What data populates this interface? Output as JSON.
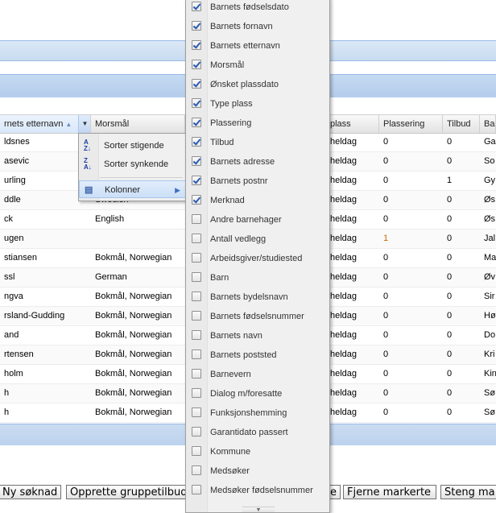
{
  "columns": {
    "etternavn": "rnets etternavn",
    "morsmal": "Morsmål",
    "plass": "plass",
    "plassering": "Plassering",
    "tilbud": "Tilbud",
    "ba": "Ba"
  },
  "rows": [
    {
      "etternavn": "ldsnes",
      "morsmal": "",
      "plass": "heldag",
      "plassering": "0",
      "tilbud": "0",
      "ba": "Ga"
    },
    {
      "etternavn": "asevic",
      "morsmal": "",
      "plass": "heldag",
      "plassering": "0",
      "tilbud": "0",
      "ba": "So"
    },
    {
      "etternavn": "urling",
      "morsmal": "",
      "plass": "heldag",
      "plassering": "0",
      "tilbud": "1",
      "ba": "Gy"
    },
    {
      "etternavn": "ddle",
      "morsmal": "Swedish",
      "plass": "heldag",
      "plassering": "0",
      "tilbud": "0",
      "ba": "Øs"
    },
    {
      "etternavn": "ck",
      "morsmal": "English",
      "plass": "heldag",
      "plassering": "0",
      "tilbud": "0",
      "ba": "Øs"
    },
    {
      "etternavn": "ugen",
      "morsmal": "",
      "plass": "heldag",
      "plassering": "1",
      "tilbud": "0",
      "ba": "Jal"
    },
    {
      "etternavn": "stiansen",
      "morsmal": "Bokmål, Norwegian",
      "plass": "heldag",
      "plassering": "0",
      "tilbud": "0",
      "ba": "Ma"
    },
    {
      "etternavn": "ssl",
      "morsmal": "German",
      "plass": "heldag",
      "plassering": "0",
      "tilbud": "0",
      "ba": "Øv"
    },
    {
      "etternavn": "ngva",
      "morsmal": "Bokmål, Norwegian",
      "plass": "heldag",
      "plassering": "0",
      "tilbud": "0",
      "ba": "Sir"
    },
    {
      "etternavn": "rsland-Gudding",
      "morsmal": "Bokmål, Norwegian",
      "plass": "heldag",
      "plassering": "0",
      "tilbud": "0",
      "ba": "Hø"
    },
    {
      "etternavn": "and",
      "morsmal": "Bokmål, Norwegian",
      "plass": "heldag",
      "plassering": "0",
      "tilbud": "0",
      "ba": "Do"
    },
    {
      "etternavn": "rtensen",
      "morsmal": "Bokmål, Norwegian",
      "plass": "heldag",
      "plassering": "0",
      "tilbud": "0",
      "ba": "Kri"
    },
    {
      "etternavn": "holm",
      "morsmal": "Bokmål, Norwegian",
      "plass": "heldag",
      "plassering": "0",
      "tilbud": "0",
      "ba": "Kin"
    },
    {
      "etternavn": "h",
      "morsmal": "Bokmål, Norwegian",
      "plass": "heldag",
      "plassering": "0",
      "tilbud": "0",
      "ba": "Sø"
    },
    {
      "etternavn": "h",
      "morsmal": "Bokmål, Norwegian",
      "plass": "heldag",
      "plassering": "0",
      "tilbud": "0",
      "ba": "Sø"
    }
  ],
  "header_menu": {
    "sort_asc": "Sorter stigende",
    "sort_desc": "Sorter synkende",
    "columns": "Kolonner"
  },
  "column_menu": [
    {
      "label": "Barnets fødselsdato",
      "checked": true
    },
    {
      "label": "Barnets fornavn",
      "checked": true
    },
    {
      "label": "Barnets etternavn",
      "checked": true
    },
    {
      "label": "Morsmål",
      "checked": true
    },
    {
      "label": "Ønsket plassdato",
      "checked": true
    },
    {
      "label": "Type plass",
      "checked": true
    },
    {
      "label": "Plassering",
      "checked": true
    },
    {
      "label": "Tilbud",
      "checked": true
    },
    {
      "label": "Barnets adresse",
      "checked": true
    },
    {
      "label": "Barnets postnr",
      "checked": true
    },
    {
      "label": "Merknad",
      "checked": true
    },
    {
      "label": "Andre barnehager",
      "checked": false
    },
    {
      "label": "Antall vedlegg",
      "checked": false
    },
    {
      "label": "Arbeidsgiver/studiested",
      "checked": false
    },
    {
      "label": "Barn",
      "checked": false
    },
    {
      "label": "Barnets bydelsnavn",
      "checked": false
    },
    {
      "label": "Barnets fødselsnummer",
      "checked": false
    },
    {
      "label": "Barnets navn",
      "checked": false
    },
    {
      "label": "Barnets poststed",
      "checked": false
    },
    {
      "label": "Barnevern",
      "checked": false
    },
    {
      "label": "Dialog m/foresatte",
      "checked": false
    },
    {
      "label": "Funksjonshemming",
      "checked": false
    },
    {
      "label": "Garantidato passert",
      "checked": false
    },
    {
      "label": "Kommune",
      "checked": false
    },
    {
      "label": "Medsøker",
      "checked": false
    },
    {
      "label": "Medsøker fødselsnummer",
      "checked": false
    }
  ],
  "buttons": {
    "ny_soknad": "Ny søknad",
    "opprette": "Opprette gruppetilbud",
    "partial": "e",
    "fjerne": "Fjerne markerte",
    "steng": "Steng ma"
  },
  "colors": {
    "accent": "#99bbe8",
    "orange_value": "#cc6600"
  }
}
